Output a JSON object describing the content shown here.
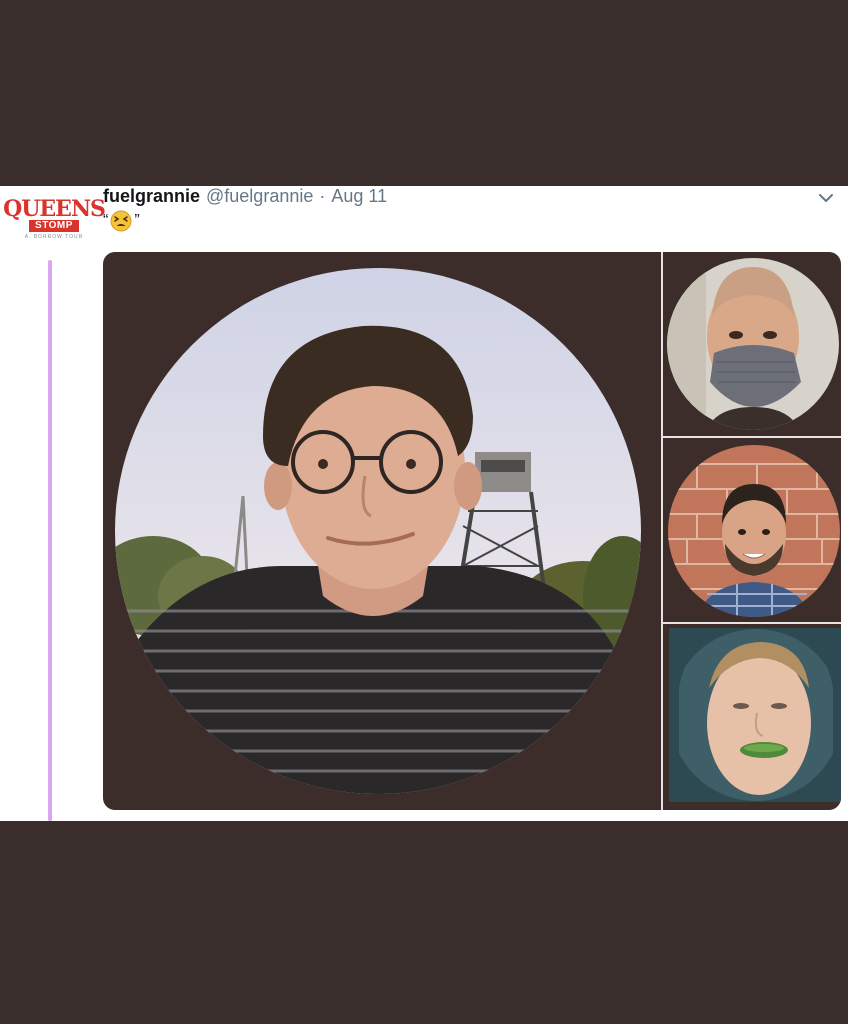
{
  "tweet": {
    "avatar": {
      "line1": "QUEENS",
      "line2": "STOMP",
      "line3": "A. BORROW TOUR"
    },
    "display_name": "fuelgrannie",
    "handle": "@fuelgrannie",
    "separator": "·",
    "date": "Aug 11",
    "text_open_quote": "“",
    "text_close_quote": "”",
    "emoji_name": "tired-face-emoji",
    "menu_icon": "chevron-down-icon"
  },
  "media": {
    "background_color": "#3c2d2a",
    "photos": [
      {
        "name": "main-photo-glasses-man",
        "shape": "circle"
      },
      {
        "name": "side-photo-masked-man",
        "shape": "circle"
      },
      {
        "name": "side-photo-brick-wall-man",
        "shape": "circle"
      },
      {
        "name": "side-photo-pickle-hoodie-man",
        "shape": "circle"
      }
    ]
  },
  "colors": {
    "frame": "#3a2e2c",
    "thread_line": "#d9a6f0",
    "logo_red": "#d8342c"
  }
}
